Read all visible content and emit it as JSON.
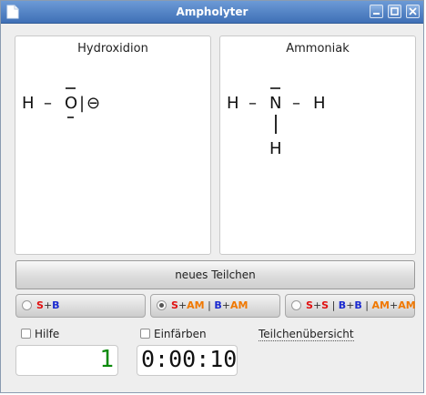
{
  "window": {
    "title": "Ampholyter",
    "controls": [
      "minimize-icon",
      "maximize-icon",
      "close-icon"
    ],
    "accent_color": "#4a7cc0"
  },
  "panels": {
    "left": {
      "title": "Hydroxidion",
      "formula_tokens": {
        "h": "H",
        "dash": "–",
        "o": "O",
        "bar": "|",
        "charge": "⊖"
      }
    },
    "right": {
      "title": "Ammoniak",
      "formula_tokens": {
        "h_left": "H",
        "dash_left": "–",
        "n": "N",
        "dash_right": "–",
        "h_right": "H",
        "h_bottom": "H"
      }
    }
  },
  "new_particle_button": "neues Teilchen",
  "modes": [
    {
      "id": "mode-1",
      "parts": [
        [
          "S",
          "r"
        ],
        [
          "+",
          "k"
        ],
        [
          "B",
          "b"
        ]
      ],
      "selected": false
    },
    {
      "id": "mode-2",
      "parts": [
        [
          "S",
          "r"
        ],
        [
          "+",
          "k"
        ],
        [
          "AM",
          "o"
        ],
        [
          " | ",
          "k"
        ],
        [
          "B",
          "b"
        ],
        [
          "+",
          "k"
        ],
        [
          "AM",
          "o"
        ]
      ],
      "selected": true
    },
    {
      "id": "mode-3",
      "parts": [
        [
          "S",
          "r"
        ],
        [
          "+",
          "k"
        ],
        [
          "S",
          "r"
        ],
        [
          " | ",
          "k"
        ],
        [
          "B",
          "b"
        ],
        [
          "+",
          "k"
        ],
        [
          "B",
          "b"
        ],
        [
          " | ",
          "k"
        ],
        [
          "AM",
          "o"
        ],
        [
          "+",
          "k"
        ],
        [
          "AM",
          "o"
        ]
      ],
      "selected": false
    }
  ],
  "options": {
    "help_label": "Hilfe",
    "help_checked": false,
    "color_label": "Einfärben",
    "color_checked": false,
    "overview_link": "Teilchenübersicht"
  },
  "counter": {
    "value": "1",
    "color": "#0b8a0b"
  },
  "timer": {
    "value": "0:00:10"
  }
}
